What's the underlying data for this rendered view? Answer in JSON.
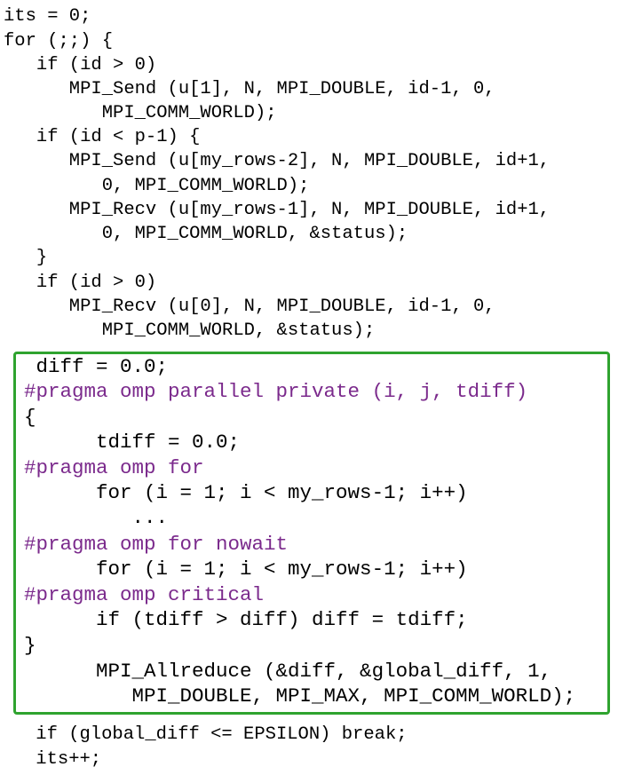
{
  "code": {
    "top_lines": [
      "its = 0;",
      "for (;;) {",
      "   if (id > 0)",
      "      MPI_Send (u[1], N, MPI_DOUBLE, id-1, 0,",
      "         MPI_COMM_WORLD);",
      "   if (id < p-1) {",
      "      MPI_Send (u[my_rows-2], N, MPI_DOUBLE, id+1,",
      "         0, MPI_COMM_WORLD);",
      "      MPI_Recv (u[my_rows-1], N, MPI_DOUBLE, id+1,",
      "         0, MPI_COMM_WORLD, &status);",
      "   }",
      "   if (id > 0)",
      "      MPI_Recv (u[0], N, MPI_DOUBLE, id-1, 0,",
      "         MPI_COMM_WORLD, &status);"
    ],
    "highlighted_lines": [
      " diff = 0.0;",
      "#pragma omp parallel private (i, j, tdiff)",
      "{",
      "      tdiff = 0.0;",
      "#pragma omp for",
      "      for (i = 1; i < my_rows-1; i++)",
      "         ...",
      "#pragma omp for nowait",
      "      for (i = 1; i < my_rows-1; i++)",
      "#pragma omp critical",
      "      if (tdiff > diff) diff = tdiff;",
      "}",
      "      MPI_Allreduce (&diff, &global_diff, 1,",
      "         MPI_DOUBLE, MPI_MAX, MPI_COMM_WORLD);"
    ],
    "bottom_lines": [
      " if (global_diff <= EPSILON) break;",
      " its++;"
    ]
  },
  "colors": {
    "pragma": "#7b2a8c",
    "highlight_border": "#2fa32f",
    "text": "#000000"
  }
}
